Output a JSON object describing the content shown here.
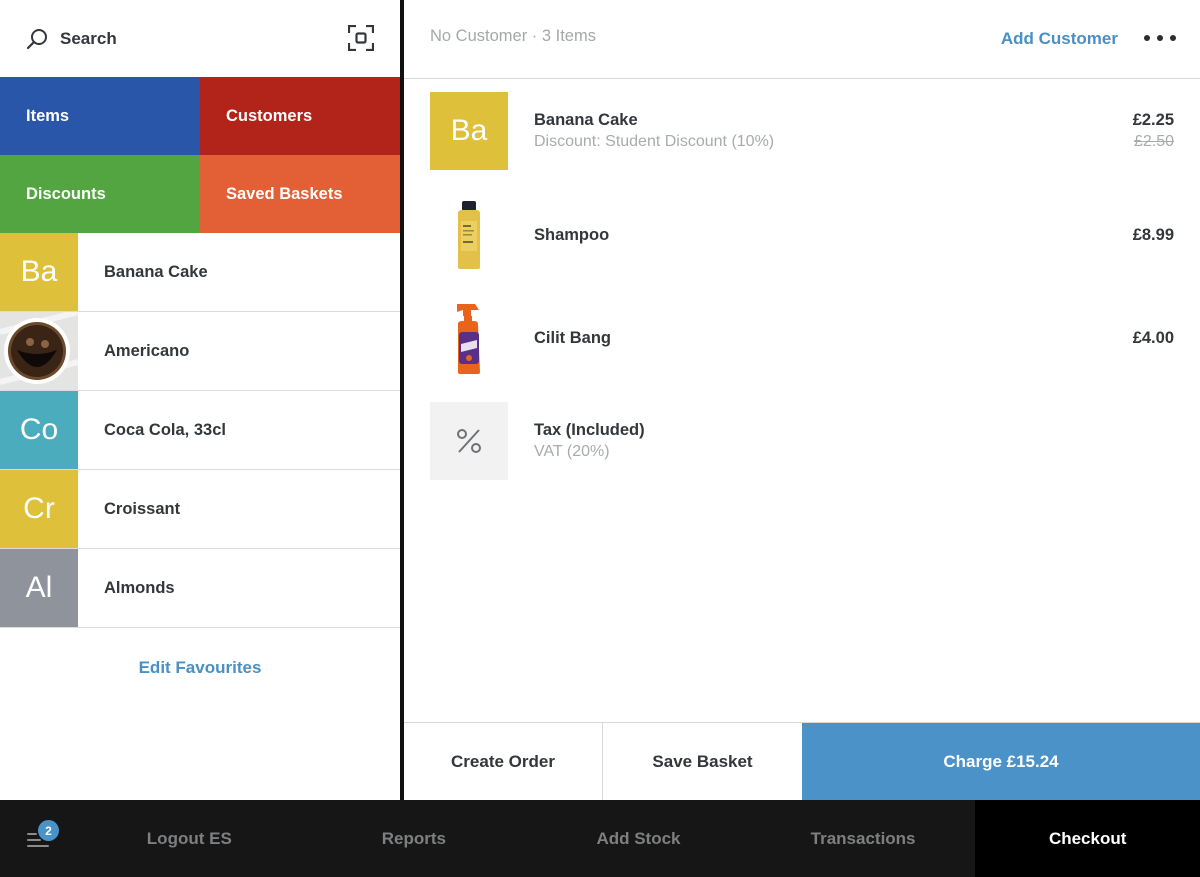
{
  "search": {
    "label": "Search"
  },
  "tiles": [
    {
      "label": "Items",
      "color": "#2a56a9"
    },
    {
      "label": "Customers",
      "color": "#b22419"
    },
    {
      "label": "Discounts",
      "color": "#53a541"
    },
    {
      "label": "Saved Baskets",
      "color": "#e36037"
    }
  ],
  "favourites": [
    {
      "initials": "Ba",
      "label": "Banana Cake",
      "color": "#dec03a",
      "image": null
    },
    {
      "initials": "",
      "label": "Americano",
      "color": "#d9d9d9",
      "image": "coffee-cup"
    },
    {
      "initials": "Co",
      "label": "Coca Cola, 33cl",
      "color": "#4aacbd",
      "image": null
    },
    {
      "initials": "Cr",
      "label": "Croissant",
      "color": "#dec03a",
      "image": null
    },
    {
      "initials": "Al",
      "label": "Almonds",
      "color": "#8f949c",
      "image": null
    }
  ],
  "edit_favourites": "Edit Favourites",
  "header": {
    "summary": "No Customer · 3 Items",
    "add_customer": "Add Customer",
    "more": "more-options-icon"
  },
  "cart": [
    {
      "name": "Banana Cake",
      "sub": "Discount: Student Discount (10%)",
      "price": "£2.25",
      "old_price": "£2.50",
      "thumb": "letter",
      "initials": "Ba",
      "color": "#dec03a"
    },
    {
      "name": "Shampoo",
      "sub": "",
      "price": "£8.99",
      "old_price": "",
      "thumb": "shampoo-bottle"
    },
    {
      "name": "Cilit Bang",
      "sub": "",
      "price": "£4.00",
      "old_price": "",
      "thumb": "spray-bottle"
    },
    {
      "name": "Tax (Included)",
      "sub": "VAT (20%)",
      "price": "",
      "old_price": "",
      "thumb": "percent"
    }
  ],
  "actions": {
    "create_order": "Create Order",
    "save_basket": "Save Basket",
    "charge": "Charge £15.24"
  },
  "nav": {
    "badge": "2",
    "items": [
      "Logout ES",
      "Reports",
      "Add Stock",
      "Transactions",
      "Checkout"
    ],
    "active": "Checkout"
  },
  "colors": {
    "accent": "#4a92c8",
    "link": "#4a90c4",
    "nav_bg": "#161616"
  }
}
